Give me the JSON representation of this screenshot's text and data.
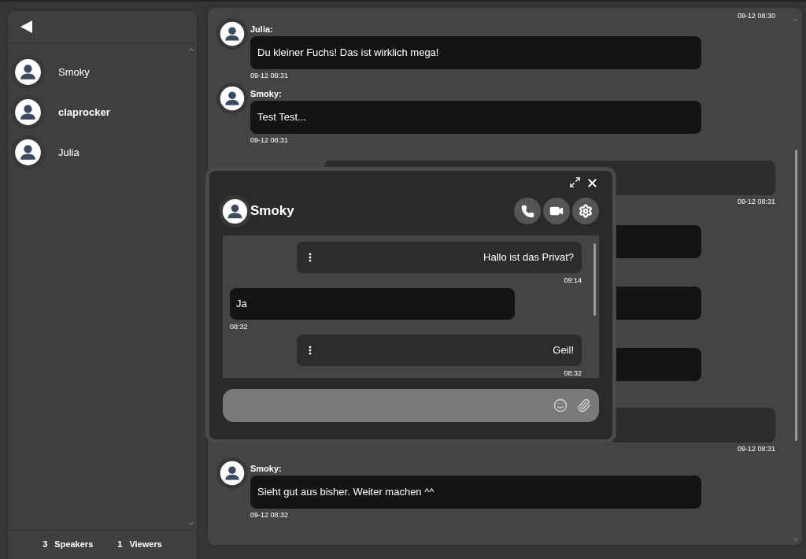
{
  "sidebar": {
    "contacts": [
      {
        "name": "Smoky",
        "unread": false
      },
      {
        "name": "claprocker",
        "unread": true
      },
      {
        "name": "Julia",
        "unread": false
      }
    ],
    "footer": {
      "speakers_count": "3",
      "speakers_label": "Speakers",
      "viewers_count": "1",
      "viewers_label": "Viewers"
    }
  },
  "chat": {
    "top_time": "09-12 08:30",
    "messages": [
      {
        "kind": "incoming",
        "author": "Julia:",
        "text": "Du kleiner Fuchs! Das ist wirklich mega!",
        "time": "09-12 08:31"
      },
      {
        "kind": "incoming",
        "author": "Smoky:",
        "text": "Test Test...",
        "time": "09-12 08:31"
      },
      {
        "kind": "outgoing",
        "time": "09-12 08:31"
      },
      {
        "kind": "incoming"
      },
      {
        "kind": "incoming"
      },
      {
        "kind": "incoming"
      },
      {
        "kind": "outgoing",
        "time": "09-12 08:31"
      },
      {
        "kind": "incoming",
        "author": "Smoky:",
        "text": "Sieht gut aus bisher. Weiter machen ^^",
        "time": "09-12 08:32"
      }
    ]
  },
  "private_chat": {
    "name": "Smoky",
    "messages": [
      {
        "kind": "outgoing",
        "text": "Hallo ist das Privat?",
        "time": "09:14"
      },
      {
        "kind": "incoming",
        "text": "Ja",
        "time": "08:32"
      },
      {
        "kind": "outgoing",
        "text": "Geil!",
        "time": "08:32"
      }
    ]
  }
}
